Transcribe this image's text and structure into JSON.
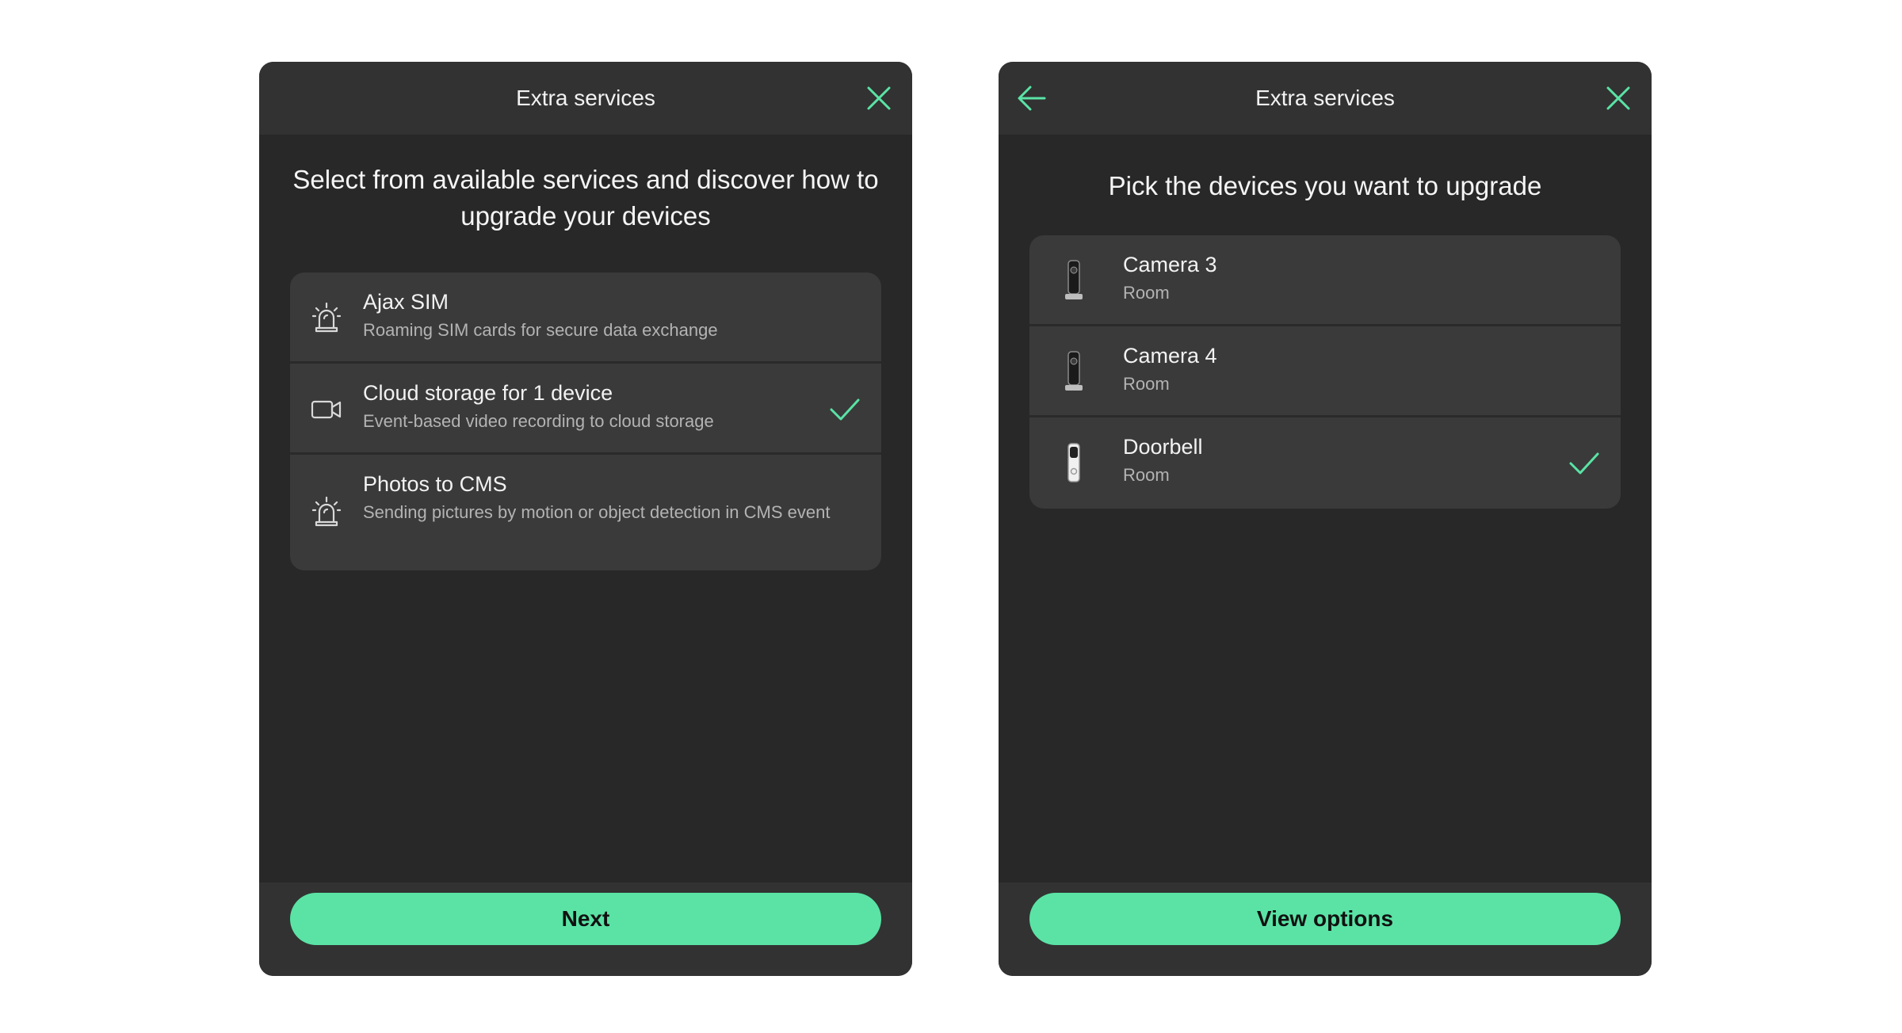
{
  "colors": {
    "accent": "#5ae3a5",
    "panel_bg": "#282828",
    "header_bg": "#323232",
    "card_bg": "#3a3a3a"
  },
  "left_panel": {
    "header": {
      "title": "Extra services",
      "close_icon": "close-icon"
    },
    "heading": "Select from available services and discover how to upgrade your devices",
    "services": [
      {
        "icon": "siren-icon",
        "title": "Ajax SIM",
        "subtitle": "Roaming SIM cards for secure data exchange",
        "selected": false
      },
      {
        "icon": "video-camera-icon",
        "title": "Cloud storage for 1 device",
        "subtitle": "Event-based video recording to cloud storage",
        "selected": true
      },
      {
        "icon": "siren-icon",
        "title": "Photos to CMS",
        "subtitle": "Sending pictures by motion or object detection in CMS event",
        "selected": false
      }
    ],
    "next_label": "Next"
  },
  "right_panel": {
    "header": {
      "title": "Extra services",
      "back_icon": "arrow-left-icon",
      "close_icon": "close-icon"
    },
    "heading": "Pick the devices you want to upgrade",
    "devices": [
      {
        "icon": "camera-device-icon",
        "title": "Camera 3",
        "subtitle": "Room",
        "selected": false
      },
      {
        "icon": "camera-device-icon",
        "title": "Camera 4",
        "subtitle": "Room",
        "selected": false
      },
      {
        "icon": "doorbell-device-icon",
        "title": "Doorbell",
        "subtitle": "Room",
        "selected": true
      }
    ],
    "view_options_label": "View options"
  }
}
